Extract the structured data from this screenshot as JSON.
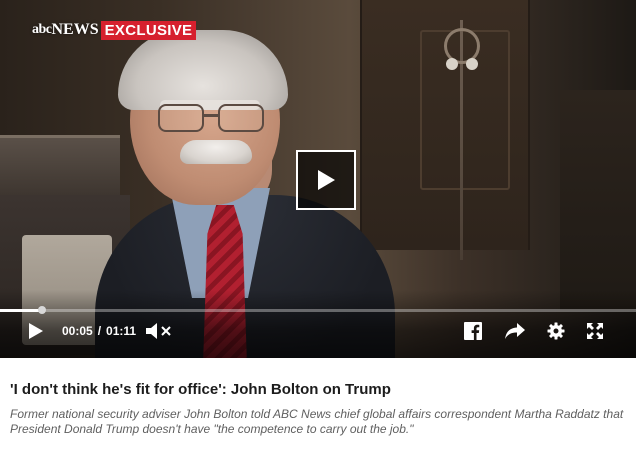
{
  "video": {
    "brand": {
      "abc_label": "abc",
      "news_label": "NEWS",
      "exclusive_label": "EXCLUSIVE",
      "exclusive_color": "#d6202e"
    },
    "current_time": "00:05",
    "separator": "/",
    "duration": "01:11",
    "progress_fraction": 0.066,
    "muted": true,
    "icons": {
      "play": "play-icon",
      "big_play": "big-play-icon",
      "volume": "volume-muted-icon",
      "share_facebook": "facebook-icon",
      "share": "share-arrow-icon",
      "settings": "gear-icon",
      "fullscreen": "fullscreen-icon"
    }
  },
  "article": {
    "headline": "'I don't think he's fit for office': John Bolton on Trump",
    "description": "Former national security adviser John Bolton told ABC News chief global affairs correspondent Martha Raddatz that President Donald Trump doesn't have \"the competence to carry out the job.\""
  }
}
